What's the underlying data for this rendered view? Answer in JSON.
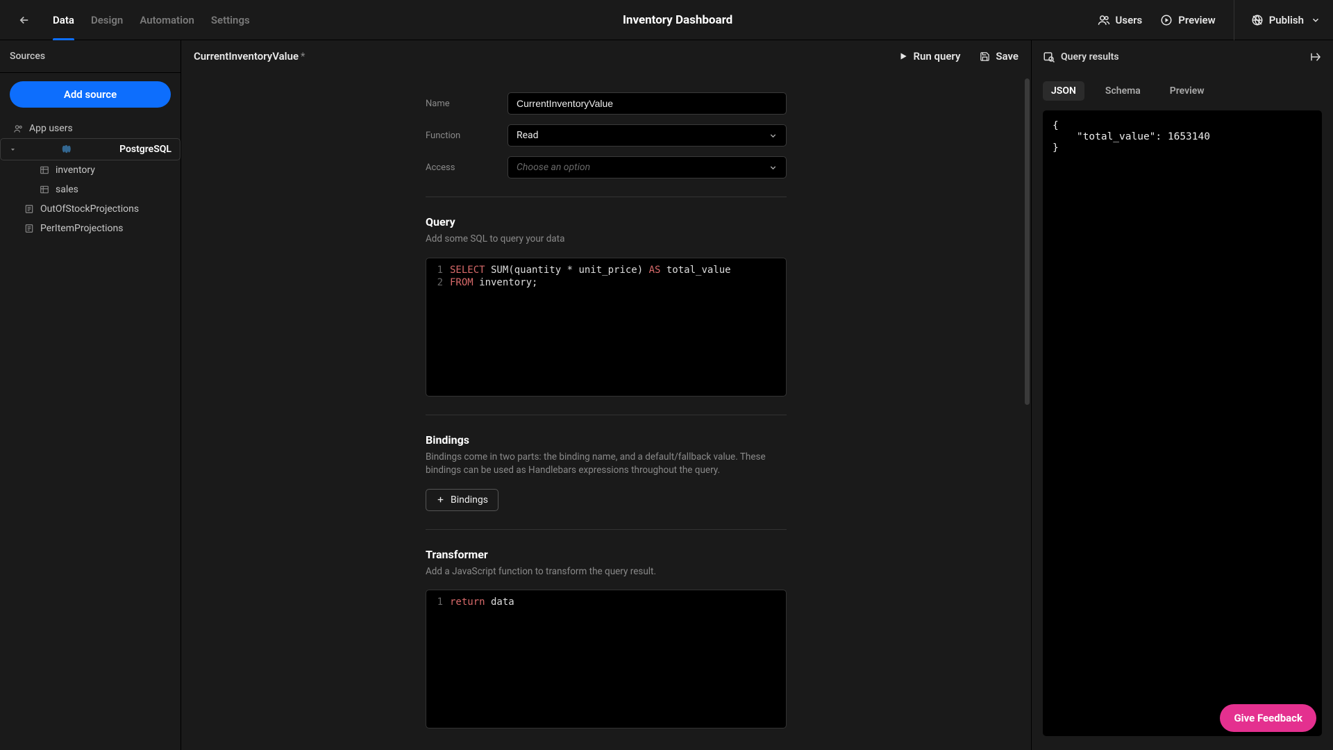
{
  "topbar": {
    "tabs": {
      "data": "Data",
      "design": "Design",
      "automation": "Automation",
      "settings": "Settings"
    },
    "title": "Inventory Dashboard",
    "users": "Users",
    "preview": "Preview",
    "publish": "Publish"
  },
  "sidebar": {
    "title": "Sources",
    "add": "Add source",
    "items": {
      "appUsers": "App users",
      "postgresql": "PostgreSQL",
      "inventory": "inventory",
      "sales": "sales",
      "oos": "OutOfStockProjections",
      "peritem": "PerItemProjections"
    }
  },
  "editor": {
    "breadcrumb": "CurrentInventoryValue",
    "dirty": "*",
    "run": "Run query",
    "save": "Save",
    "nameLabel": "Name",
    "nameValue": "CurrentInventoryValue",
    "functionLabel": "Function",
    "functionValue": "Read",
    "accessLabel": "Access",
    "accessPlaceholder": "Choose an option",
    "queryTitle": "Query",
    "querySub": "Add some SQL to query your data",
    "sql": {
      "l1_select": "SELECT",
      "l1_rest": " SUM(quantity * unit_price) ",
      "l1_as": "AS",
      "l1_alias": " total_value",
      "l2_from": "FROM",
      "l2_rest": " inventory;"
    },
    "bindingsTitle": "Bindings",
    "bindingsSub": "Bindings come in two parts: the binding name, and a default/fallback value. These bindings can be used as Handlebars expressions throughout the query.",
    "bindingsBtn": "Bindings",
    "transformerTitle": "Transformer",
    "transformerSub": "Add a JavaScript function to transform the query result.",
    "js": {
      "ret": "return",
      "rest": " data"
    }
  },
  "results": {
    "title": "Query results",
    "tabs": {
      "json": "JSON",
      "schema": "Schema",
      "preview": "Preview"
    },
    "json": "{\n    \"total_value\": 1653140\n}"
  },
  "feedback": "Give Feedback"
}
